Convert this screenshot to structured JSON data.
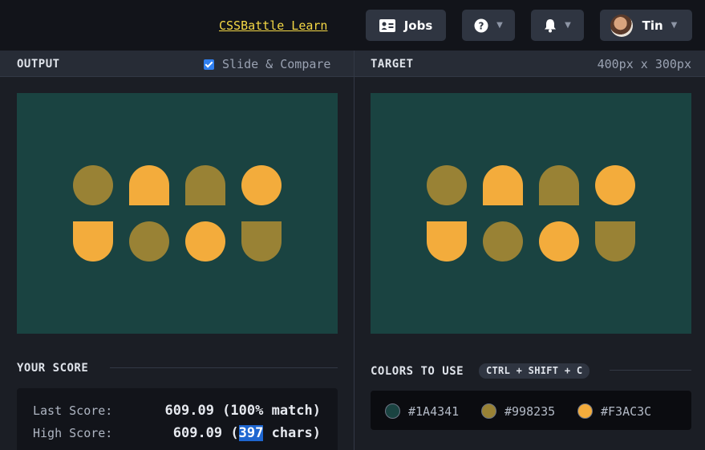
{
  "nav": {
    "learn_link": "CSSBattle Learn",
    "jobs_label": "Jobs",
    "user_name": "Tin",
    "icons": [
      "id-card-icon",
      "help-icon",
      "bell-icon",
      "chevron-down-icon",
      "avatar"
    ]
  },
  "output": {
    "title": "OUTPUT",
    "compare_label": "Slide & Compare",
    "compare_checked": true
  },
  "target": {
    "title": "TARGET",
    "dims": "400px x 300px"
  },
  "canvas": {
    "background": "#1A4341",
    "shapes": [
      {
        "kind": "circle",
        "color": "#998235"
      },
      {
        "kind": "arch",
        "color": "#F3AC3C"
      },
      {
        "kind": "arch",
        "color": "#998235"
      },
      {
        "kind": "circle",
        "color": "#F3AC3C"
      },
      {
        "kind": "cup",
        "color": "#F3AC3C"
      },
      {
        "kind": "circle",
        "color": "#998235"
      },
      {
        "kind": "circle",
        "color": "#F3AC3C"
      },
      {
        "kind": "cup",
        "color": "#998235"
      }
    ]
  },
  "score": {
    "title": "YOUR SCORE",
    "last_label": "Last Score:",
    "last_value": "609.09 (100% match)",
    "high_label": "High Score:",
    "high_prefix": "609.09 (",
    "high_highlight": "397",
    "high_suffix": " chars)"
  },
  "colors": {
    "title": "COLORS TO USE",
    "shortcut": "CTRL + SHIFT + C",
    "swatches": [
      {
        "hex": "#1A4341"
      },
      {
        "hex": "#998235"
      },
      {
        "hex": "#F3AC3C"
      }
    ]
  }
}
